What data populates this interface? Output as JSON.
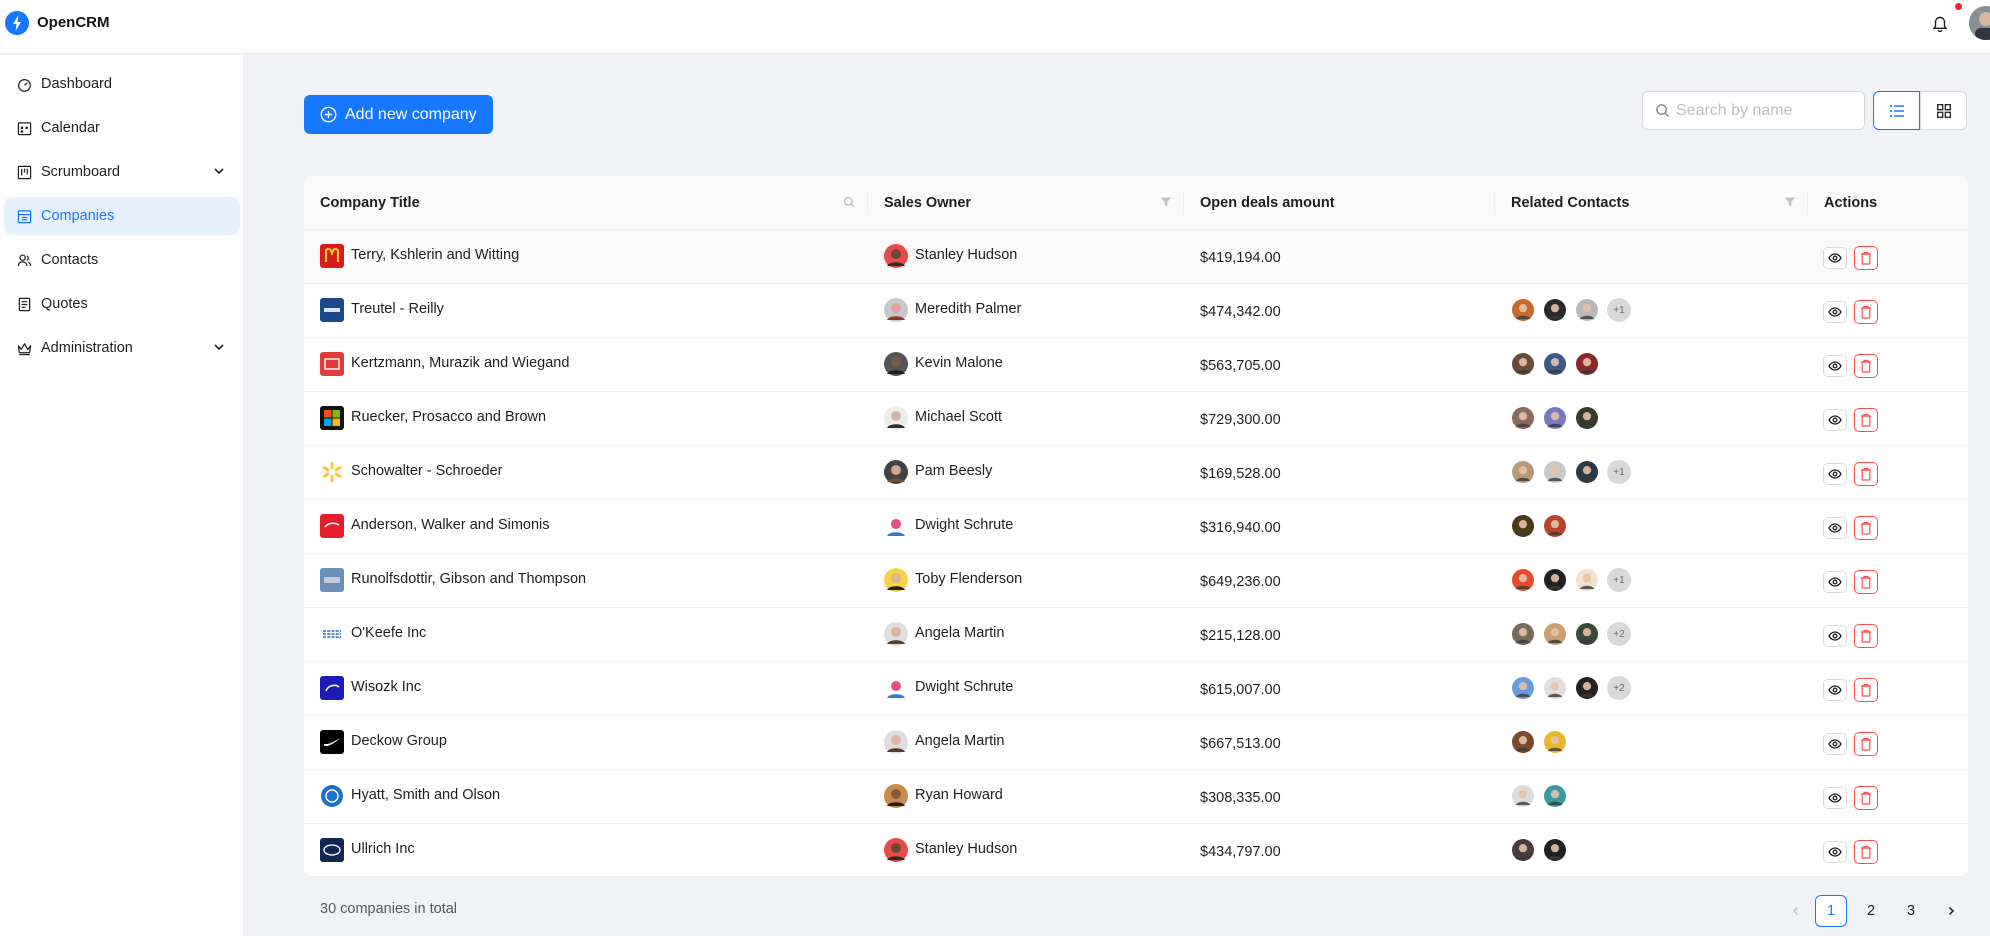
{
  "app": {
    "name": "OpenCRM"
  },
  "topbar": {
    "notifications_icon": "bell-icon",
    "avatar": "user-avatar"
  },
  "sidebar": {
    "items": [
      {
        "label": "Dashboard",
        "icon": "dashboard-icon"
      },
      {
        "label": "Calendar",
        "icon": "calendar-icon"
      },
      {
        "label": "Scrumboard",
        "icon": "project-icon",
        "expandable": true
      },
      {
        "label": "Companies",
        "icon": "shop-icon",
        "active": true
      },
      {
        "label": "Contacts",
        "icon": "team-icon"
      },
      {
        "label": "Quotes",
        "icon": "container-icon"
      },
      {
        "label": "Administration",
        "icon": "crown-icon",
        "expandable": true
      }
    ]
  },
  "toolbar": {
    "add_label": "Add new company",
    "search_placeholder": "Search by name",
    "view_modes": [
      "list",
      "grid"
    ],
    "active_view": "list"
  },
  "table": {
    "columns": [
      "Company Title",
      "Sales Owner",
      "Open deals amount",
      "Related Contacts",
      "Actions"
    ],
    "rows": [
      {
        "company": "Terry, Kshlerin and Witting",
        "owner": "Stanley Hudson",
        "amount": "$419,194.00",
        "contacts": 0,
        "more": ""
      },
      {
        "company": "Treutel - Reilly",
        "owner": "Meredith Palmer",
        "amount": "$474,342.00",
        "contacts": 3,
        "more": "+1"
      },
      {
        "company": "Kertzmann, Murazik and Wiegand",
        "owner": "Kevin Malone",
        "amount": "$563,705.00",
        "contacts": 3,
        "more": ""
      },
      {
        "company": "Ruecker, Prosacco and Brown",
        "owner": "Michael Scott",
        "amount": "$729,300.00",
        "contacts": 3,
        "more": ""
      },
      {
        "company": "Schowalter - Schroeder",
        "owner": "Pam Beesly",
        "amount": "$169,528.00",
        "contacts": 3,
        "more": "+1"
      },
      {
        "company": "Anderson, Walker and Simonis",
        "owner": "Dwight Schrute",
        "amount": "$316,940.00",
        "contacts": 2,
        "more": ""
      },
      {
        "company": "Runolfsdottir, Gibson and Thompson",
        "owner": "Toby Flenderson",
        "amount": "$649,236.00",
        "contacts": 3,
        "more": "+1"
      },
      {
        "company": "O'Keefe Inc",
        "owner": "Angela Martin",
        "amount": "$215,128.00",
        "contacts": 3,
        "more": "+2"
      },
      {
        "company": "Wisozk Inc",
        "owner": "Dwight Schrute",
        "amount": "$615,007.00",
        "contacts": 3,
        "more": "+2"
      },
      {
        "company": "Deckow Group",
        "owner": "Angela Martin",
        "amount": "$667,513.00",
        "contacts": 2,
        "more": ""
      },
      {
        "company": "Hyatt, Smith and Olson",
        "owner": "Ryan Howard",
        "amount": "$308,335.00",
        "contacts": 2,
        "more": ""
      },
      {
        "company": "Ullrich Inc",
        "owner": "Stanley Hudson",
        "amount": "$434,797.00",
        "contacts": 2,
        "more": ""
      }
    ]
  },
  "footer": {
    "total": "30 companies in total",
    "pages": [
      "1",
      "2",
      "3"
    ],
    "current_page": "1"
  },
  "colors": {
    "primary": "#1677ff",
    "danger": "#ff4d4f",
    "background": "#f0f2f5"
  }
}
